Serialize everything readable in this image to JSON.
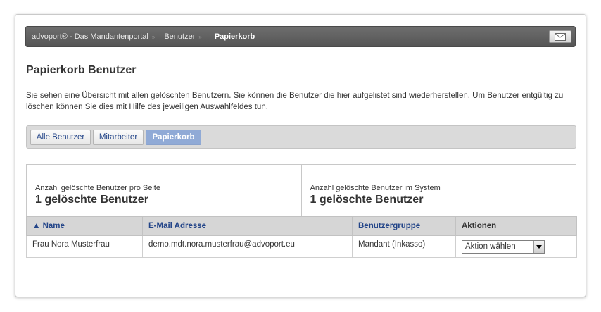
{
  "breadcrumb": [
    "advoport® - Das Mandantenportal",
    "Benutzer",
    "Papierkorb"
  ],
  "page_title": "Papierkorb Benutzer",
  "intro": "Sie sehen eine Übersicht mit allen gelöschten Benutzern. Sie können die Benutzer die hier aufgelistet sind wiederherstellen. Um Benutzer entgültig zu löschen können Sie dies mit Hilfe des jeweiligen Auswahlfeldes tun.",
  "tabs": [
    "Alle Benutzer",
    "Mitarbeiter",
    "Papierkorb"
  ],
  "active_tab": "Papierkorb",
  "stats": [
    {
      "label": "Anzahl gelöschte Benutzer pro Seite",
      "value": "1 gelöschte Benutzer"
    },
    {
      "label": "Anzahl gelöschte Benutzer im System",
      "value": "1 gelöschte Benutzer"
    }
  ],
  "table": {
    "columns": [
      "▲ Name",
      "E-Mail Adresse",
      "Benutzergruppe",
      "Aktionen"
    ],
    "rows": [
      {
        "name": "Frau Nora Musterfrau",
        "email": "demo.mdt.nora.musterfrau@advoport.eu",
        "group": "Mandant (Inkasso)",
        "action": "Aktion wählen"
      }
    ]
  },
  "colors": {
    "tab_active": "#90aad6",
    "link": "#224488",
    "topbar": "#5f5f5f"
  },
  "icons": {
    "mail": "mail-icon",
    "sort": "sort-up-arrow"
  }
}
